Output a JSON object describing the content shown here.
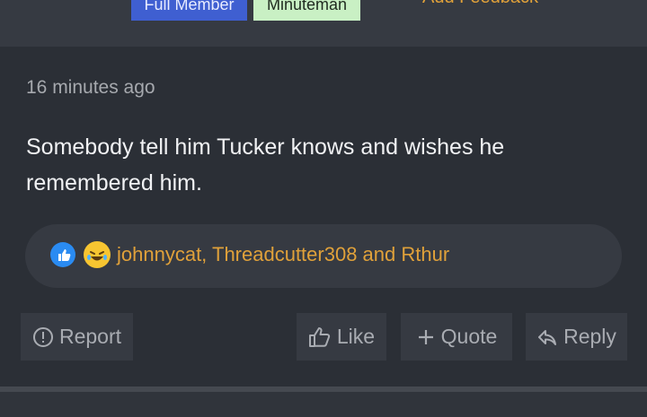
{
  "header": {
    "badges": [
      "Full Member",
      "Minuteman"
    ],
    "feedback_label": "Add Feedback"
  },
  "post": {
    "timestamp": "16 minutes ago",
    "message": "Somebody tell him Tucker knows and wishes he remembered him.",
    "reactions": {
      "icons": [
        "like-icon",
        "laughing-emoji-icon"
      ],
      "users_text": "johnnycat, Threadcutter308 and Rthur"
    }
  },
  "actions": {
    "report": "Report",
    "like": "Like",
    "quote": "Quote",
    "reply": "Reply"
  },
  "colors": {
    "background": "#2b2f36",
    "panel": "#363a42",
    "accent_orange": "#e0a13a",
    "badge_blue": "#3f5fd1",
    "badge_green": "#c9f0c4"
  }
}
